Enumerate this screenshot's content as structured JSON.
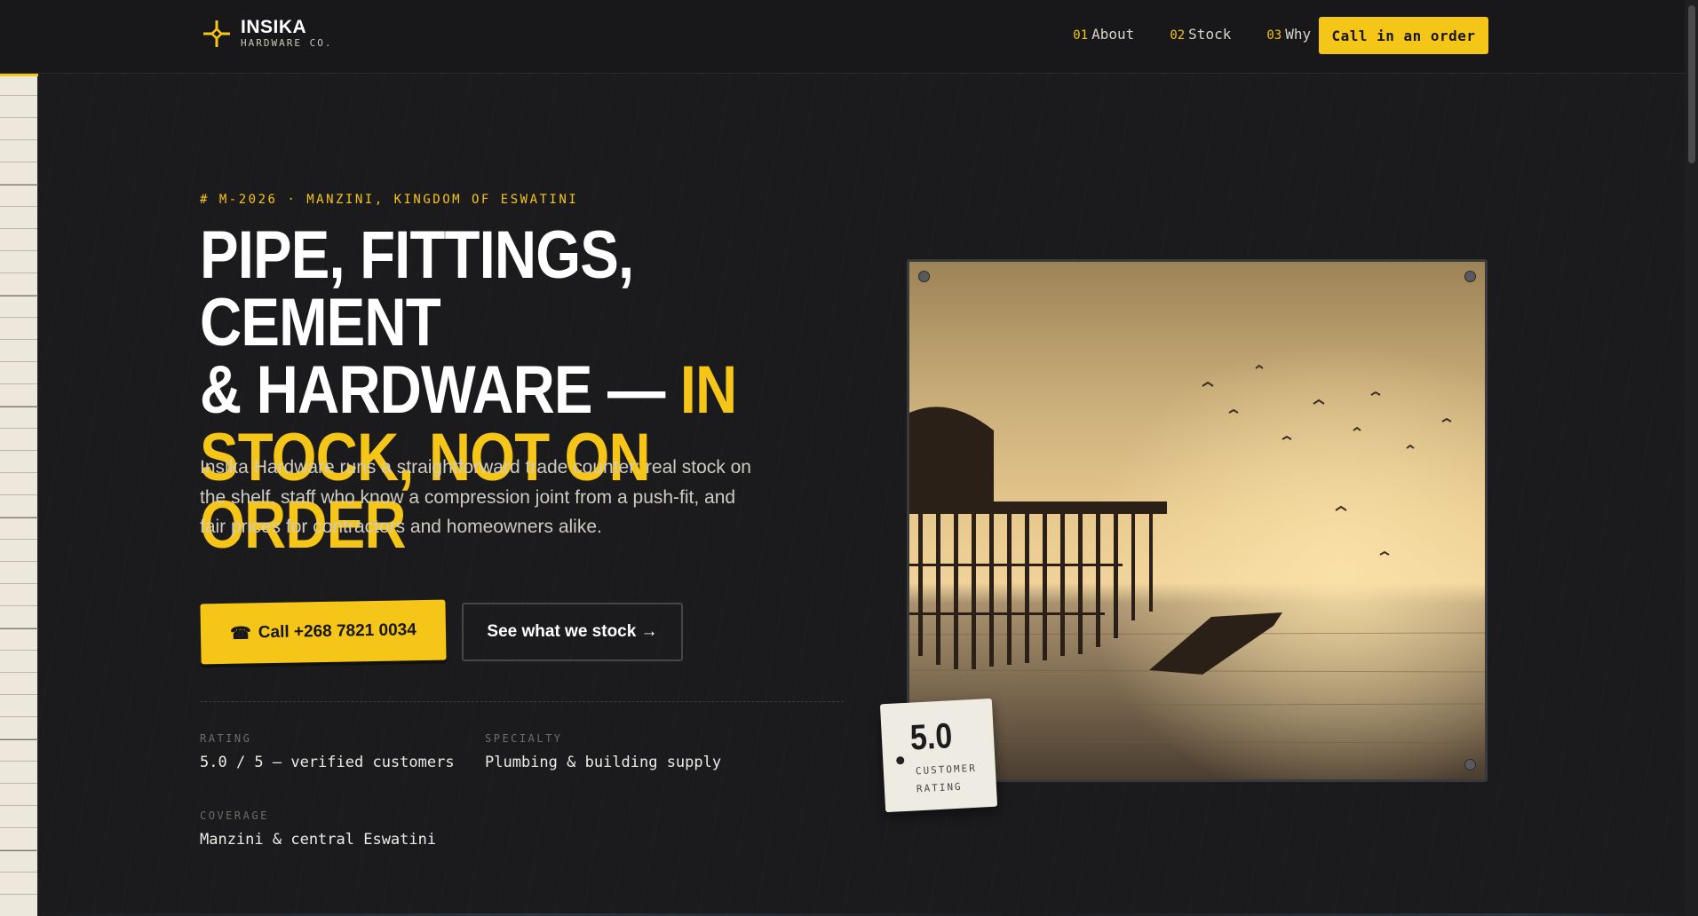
{
  "brand": {
    "name": "INSIKA",
    "sub": "HARDWARE CO.",
    "logo_icon": "crosshair-sparkle-icon"
  },
  "nav": {
    "items": [
      {
        "num": "01",
        "label": "About"
      },
      {
        "num": "02",
        "label": "Stock"
      },
      {
        "num": "03",
        "label": "Why us"
      }
    ],
    "cta_label": "Call in an order"
  },
  "hero": {
    "eyebrow": "# M-2026 · MANZINI, KINGDOM OF ESWATINI",
    "title_line1": "PIPE, FITTINGS, CEMENT",
    "title_line2a": "& HARDWARE — ",
    "title_line2b": "IN",
    "title_line3": "STOCK, NOT ON ORDER",
    "lede": "Insika Hardware runs a straightforward trade counter: real stock on the shelf, staff who know a compression joint from a push-fit, and fair prices for contractors and homeowners alike.",
    "call_icon": "phone-icon",
    "call_label": "Call +268 7821 0034",
    "stock_label": "See what we stock →"
  },
  "stats": {
    "rating_label": "RATING",
    "rating_value": "5.0 / 5 — verified customers",
    "specialty_label": "SPECIALTY",
    "specialty_value": "Plumbing & building supply",
    "coverage_label": "COVERAGE",
    "coverage_value": "Manzini & central Eswatini"
  },
  "badge": {
    "score": "5.0",
    "caption": "CUSTOMER RATING"
  },
  "colors": {
    "accent": "#f5c518",
    "background": "#1b1b1d",
    "badge_bg": "#eeebe2"
  }
}
